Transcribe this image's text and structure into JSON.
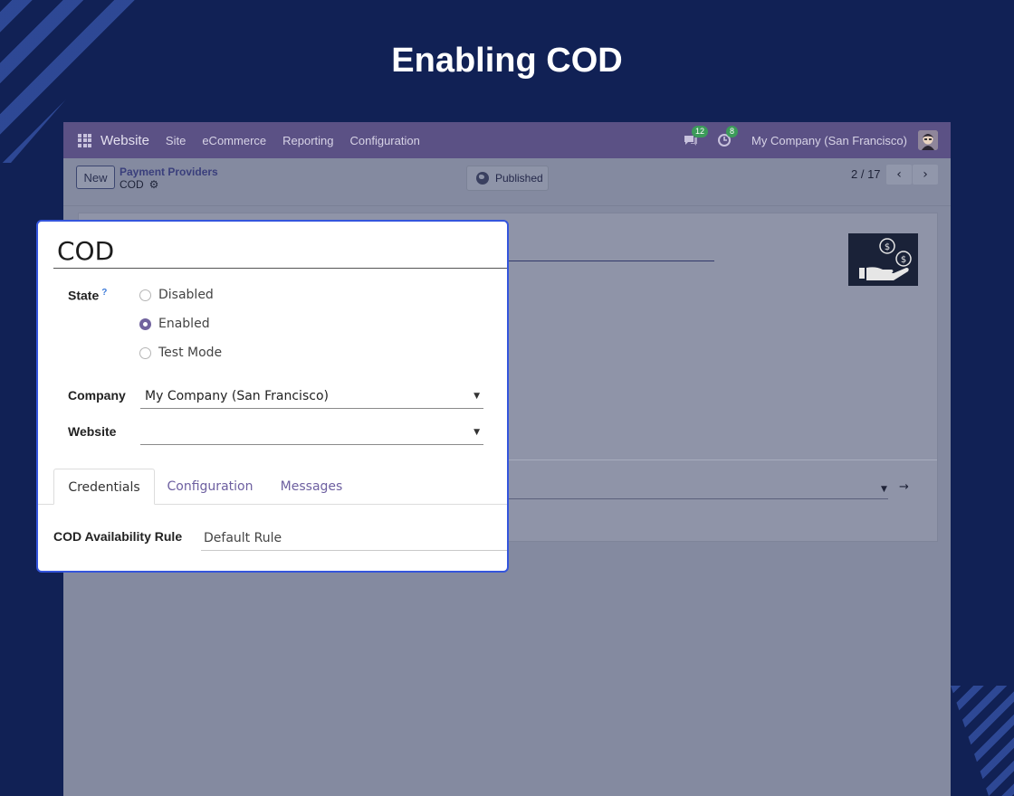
{
  "slide": {
    "title": "Enabling COD"
  },
  "navbar": {
    "app_name": "Website",
    "menu": [
      "Site",
      "eCommerce",
      "Reporting",
      "Configuration"
    ],
    "messages_count": "12",
    "activities_count": "8",
    "company": "My Company (San Francisco)"
  },
  "controlbar": {
    "new_label": "New",
    "breadcrumb_parent": "Payment Providers",
    "breadcrumb_current": "COD",
    "published_label": "Published",
    "pager": "2 / 17"
  },
  "form": {
    "record_name": "COD",
    "state_label": "State",
    "state_help": "?",
    "state_options": [
      "Disabled",
      "Enabled",
      "Test Mode"
    ],
    "state_selected": "Enabled",
    "company_label": "Company",
    "company_value": "My Company (San Francisco)",
    "website_label": "Website",
    "website_value": "",
    "tabs": [
      "Credentials",
      "Configuration",
      "Messages"
    ],
    "active_tab": "Credentials",
    "rule_label": "COD Availability Rule",
    "rule_value": "Default Rule"
  },
  "colors": {
    "slide_background": "#112155",
    "card_border": "#3455dc",
    "navbar": "#5b5185",
    "accent": "#71639e"
  }
}
